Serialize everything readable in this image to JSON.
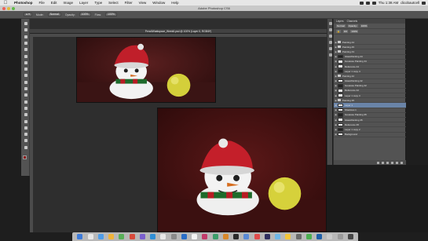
{
  "menubar": {
    "app_name": "Photoshop",
    "items": [
      "File",
      "Edit",
      "Image",
      "Layer",
      "Type",
      "Select",
      "Filter",
      "View",
      "Window",
      "Help"
    ],
    "clock": "Thu 1:38 AM",
    "user": "dicobautcell"
  },
  "window": {
    "title": "Adobe Photoshop CS6"
  },
  "options_bar": {
    "mode_label": "Mode:",
    "mode_value": "Normal",
    "opacity_label": "Opacity:",
    "opacity_value": "100%",
    "flow_label": "Flow:",
    "flow_value": "100%"
  },
  "document": {
    "tab_title": "PencilWorkspace_Week6.psd @ 100% (Layer 0, RGB/8*)"
  },
  "layers_panel": {
    "tabs": [
      "Layers",
      "Channels"
    ],
    "blend_mode": "Normal",
    "opacity_label": "Opacity:",
    "opacity_value": "100%",
    "fill_label": "Fill:",
    "fill_value": "100%",
    "layers": [
      {
        "name": "Painting 44",
        "type": "group",
        "selected": false
      },
      {
        "name": "Painting 45",
        "type": "group",
        "selected": false
      },
      {
        "name": "Painting 43",
        "type": "group",
        "selected": false
      },
      {
        "name": "GlassPainting 44",
        "type": "layer",
        "selected": false
      },
      {
        "name": "Gouasse Painting 44",
        "type": "layer",
        "selected": false
      },
      {
        "name": "Reference 44",
        "type": "layer",
        "selected": false
      },
      {
        "name": "Layer 1 copy 4",
        "type": "layer",
        "selected": false
      },
      {
        "name": "Painting 42",
        "type": "group",
        "selected": false
      },
      {
        "name": "GlassPainting 42",
        "type": "layer",
        "selected": false
      },
      {
        "name": "Gouasse Painting 42",
        "type": "layer",
        "selected": false
      },
      {
        "name": "Reference 42",
        "type": "layer",
        "selected": false
      },
      {
        "name": "Layer 1 copy 3",
        "type": "layer",
        "selected": false
      },
      {
        "name": "Painting 35",
        "type": "group",
        "selected": false
      },
      {
        "name": "Layer 1",
        "type": "layer",
        "selected": true
      },
      {
        "name": "Shadows 1",
        "type": "layer",
        "selected": false
      },
      {
        "name": "Gouasse Painting 35",
        "type": "layer",
        "selected": false
      },
      {
        "name": "GlassPainting 35",
        "type": "layer",
        "selected": false
      },
      {
        "name": "Reference 35",
        "type": "layer",
        "selected": false
      },
      {
        "name": "Layer 1 copy 2",
        "type": "layer",
        "selected": false
      },
      {
        "name": "Background",
        "type": "layer",
        "selected": false
      }
    ]
  },
  "colors": {
    "menubar_bg": "#e7e7e7",
    "panel_bg": "#535353",
    "workspace_bg": "#2e2e2e",
    "selection_blue": "#6a84a8",
    "foreground_swatch": "#8b1a1a",
    "background_swatch": "#ffffff"
  },
  "icons": {
    "tools": [
      "move-tool-icon",
      "marquee-tool-icon",
      "lasso-tool-icon",
      "quick-select-icon",
      "crop-tool-icon",
      "eyedropper-icon",
      "healing-brush-icon",
      "brush-tool-icon",
      "clone-stamp-icon",
      "history-brush-icon",
      "eraser-icon",
      "gradient-icon",
      "blur-icon",
      "dodge-icon",
      "pen-tool-icon",
      "type-tool-icon",
      "path-select-icon",
      "shape-tool-icon",
      "hand-tool-icon",
      "zoom-tool-icon"
    ]
  }
}
